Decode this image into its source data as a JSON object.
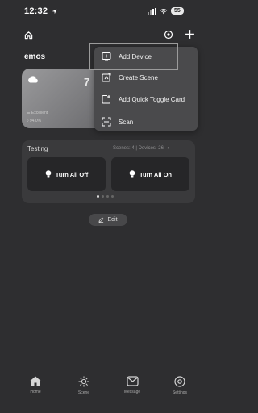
{
  "status_bar": {
    "time": "12:32",
    "battery": "55"
  },
  "home": {
    "name": "emos"
  },
  "weather": {
    "temperature": "7",
    "air_quality": "Excellent",
    "humidity": "94.0%"
  },
  "menu": {
    "items": [
      {
        "label": "Add Device",
        "icon": "add-device-icon"
      },
      {
        "label": "Create Scene",
        "icon": "create-scene-icon"
      },
      {
        "label": "Add Quick Toggle Card",
        "icon": "quick-toggle-icon"
      },
      {
        "label": "Scan",
        "icon": "scan-icon"
      }
    ]
  },
  "room": {
    "title": "Testing",
    "stats": "Scenes: 4  |  Devices: 26",
    "buttons": [
      {
        "label": "Turn All Off"
      },
      {
        "label": "Turn All On"
      }
    ],
    "page_index": 1,
    "page_count": 4
  },
  "edit_label": "Edit",
  "nav": {
    "items": [
      {
        "label": "Home",
        "icon": "home-icon"
      },
      {
        "label": "Scene",
        "icon": "scene-icon"
      },
      {
        "label": "Message",
        "icon": "message-icon"
      },
      {
        "label": "Settings",
        "icon": "settings-icon"
      }
    ]
  },
  "colors": {
    "background": "#2e2e30",
    "card": "#3a3a3c",
    "menu": "#4a4a4c",
    "highlight_box": "#9b9b9b"
  }
}
